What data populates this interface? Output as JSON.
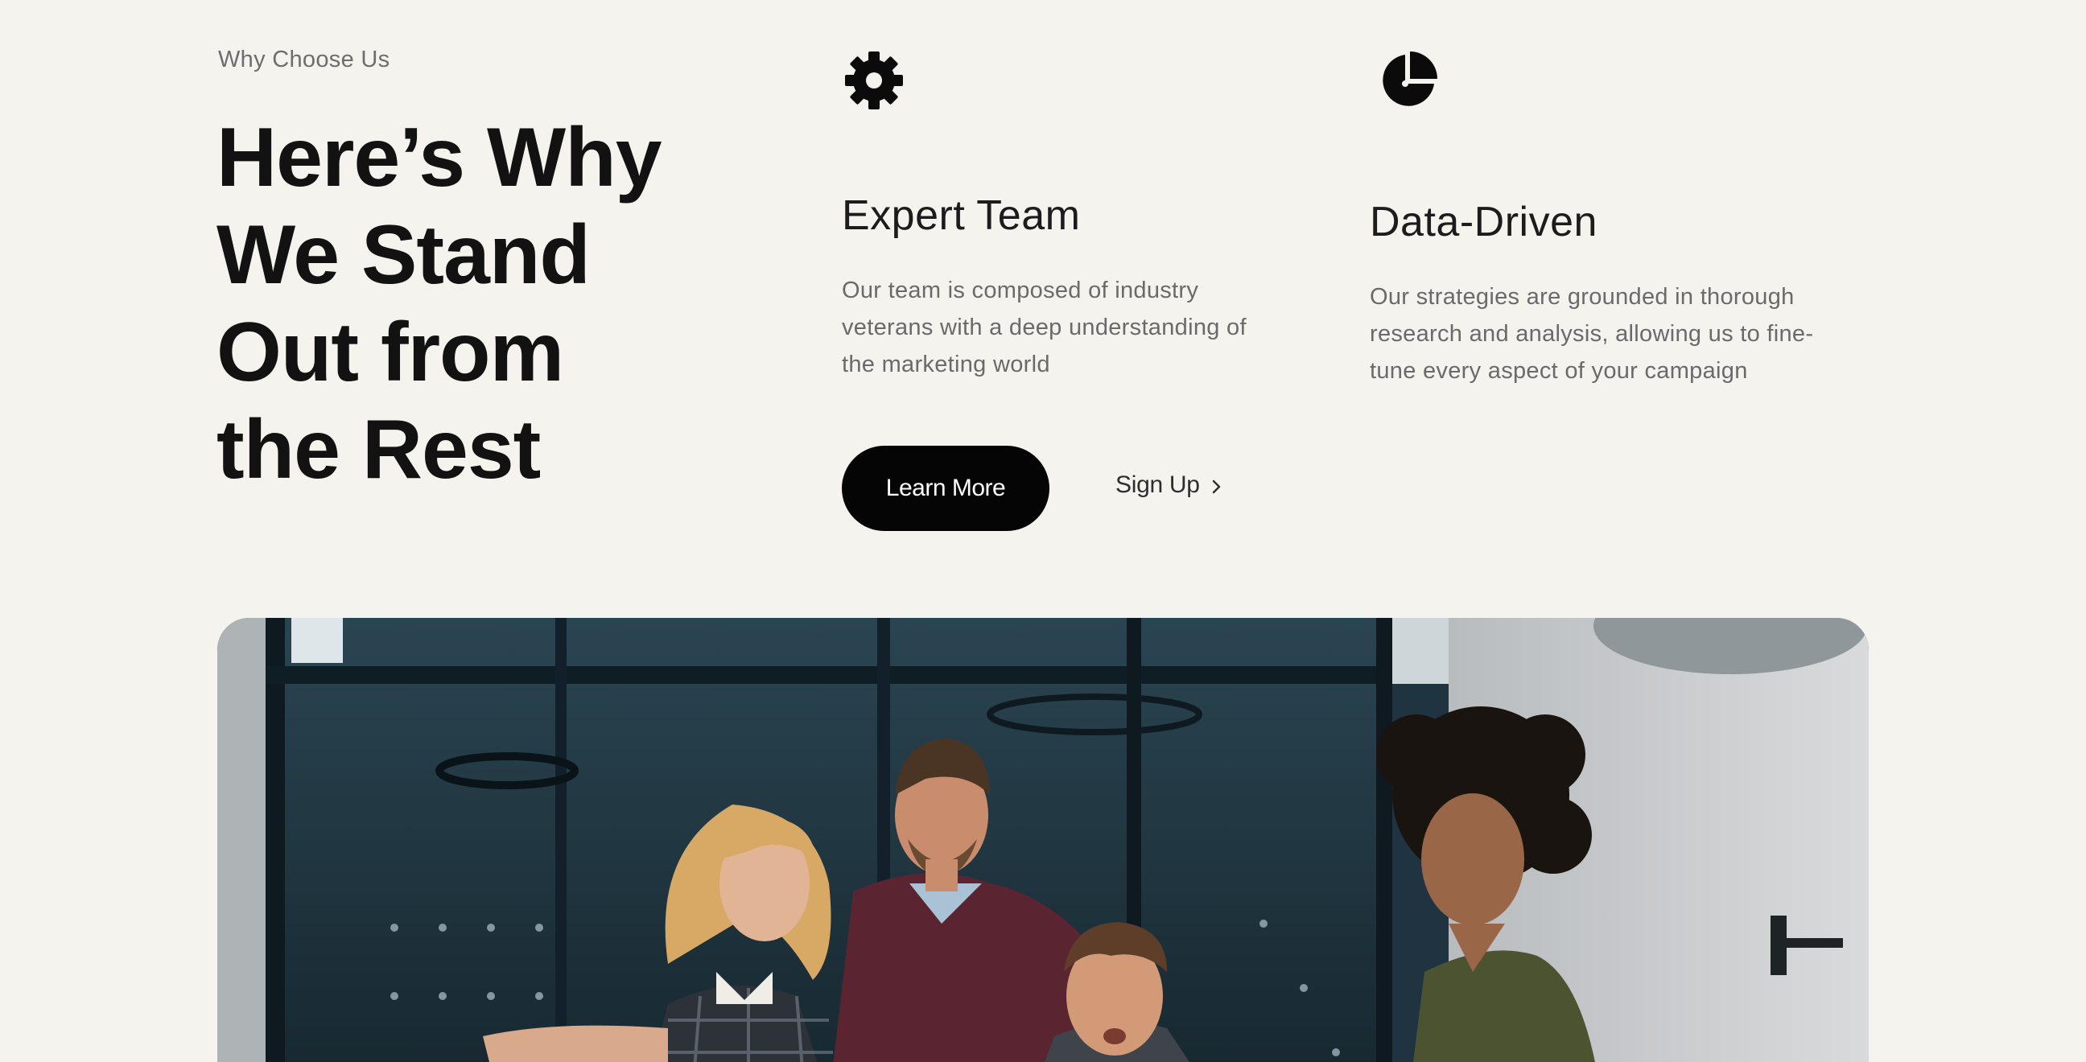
{
  "section": {
    "eyebrow": "Why Choose Us",
    "headline_lines": [
      "Here’s Why",
      "We Stand",
      "Out from",
      "the Rest"
    ]
  },
  "features": [
    {
      "icon": "gear-icon",
      "title": "Expert Team",
      "description_lines": [
        "Our team is composed of industry",
        "veterans with a deep understanding of",
        "the marketing world"
      ]
    },
    {
      "icon": "pie-chart-icon",
      "title": "Data-Driven",
      "description_lines": [
        "Our strategies are grounded in thorough",
        "research and analysis, allowing us to fine-",
        "tune every aspect of your campaign"
      ]
    }
  ],
  "cta": {
    "primary_label": "Learn More",
    "secondary_label": "Sign Up",
    "secondary_icon": "chevron-right-icon"
  },
  "colors": {
    "background": "#f5f3ee",
    "text": "#141414",
    "muted_text": "#6a6a6a",
    "button_bg": "#050505",
    "button_text": "#ffffff"
  },
  "hero_image": {
    "content": "team-meeting-photo"
  }
}
